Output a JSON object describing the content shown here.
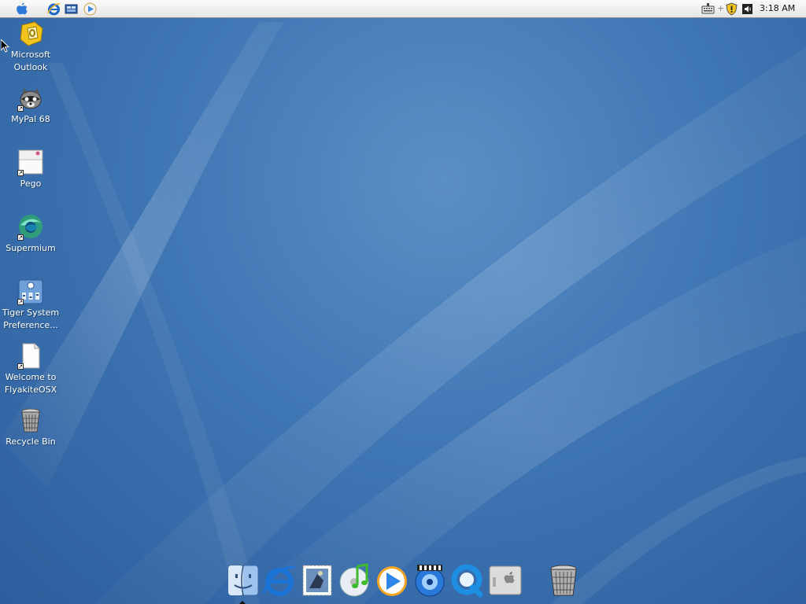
{
  "menubar": {
    "apple_icon": "apple-logo-icon",
    "quick_launch": [
      "internet-explorer-icon",
      "show-desktop-icon",
      "media-player-icon"
    ],
    "tray": [
      "keyboard-icon",
      "plus-icon",
      "security-shield-icon",
      "volume-icon"
    ],
    "clock": "3:18 AM"
  },
  "desktop_icons": [
    {
      "label": "Microsoft Outlook",
      "icon": "outlook-icon"
    },
    {
      "label": "MyPal 68",
      "icon": "mypal-raccoon-icon"
    },
    {
      "label": "Pego",
      "icon": "pego-window-icon"
    },
    {
      "label": "Supermium",
      "icon": "supermium-browser-icon"
    },
    {
      "label": "Tiger System Preference...",
      "icon": "system-preferences-icon"
    },
    {
      "label": "Welcome to FlyakiteOSX",
      "icon": "document-icon"
    },
    {
      "label": "Recycle Bin",
      "icon": "recycle-bin-icon"
    }
  ],
  "dock": {
    "items": [
      "finder-icon",
      "internet-explorer-icon",
      "mail-stamp-icon",
      "itunes-icon",
      "windows-media-player-icon",
      "dvd-player-icon",
      "quicktime-icon",
      "system-panel-icon",
      "trash-icon"
    ]
  },
  "colors": {
    "desktop_blue": "#3f76b4",
    "menubar": "#efefef",
    "label_text": "#ffffff"
  }
}
